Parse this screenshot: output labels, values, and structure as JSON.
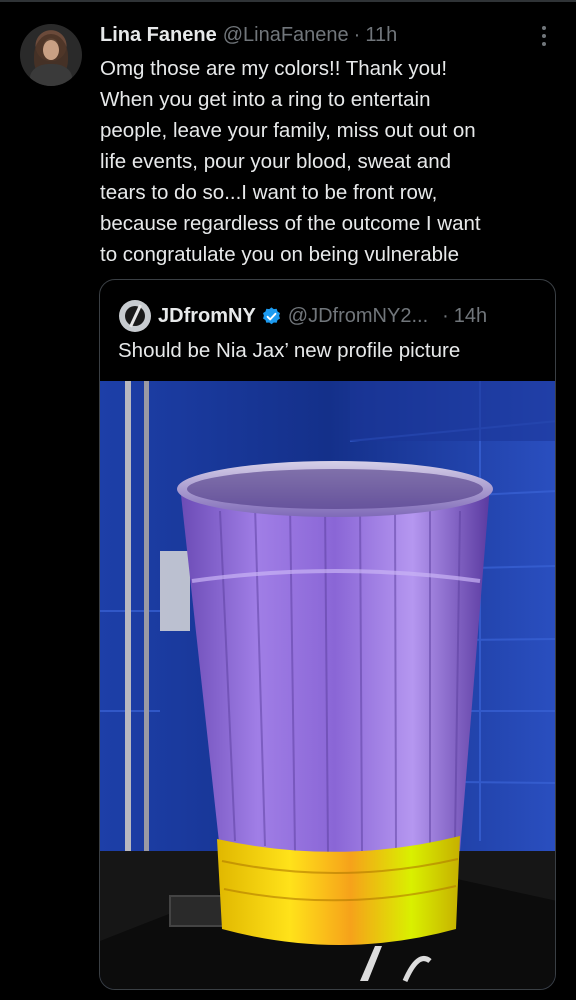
{
  "tweet": {
    "author_name": "Lina Fanene",
    "author_handle": "@LinaFanene",
    "separator": "·",
    "time": "11h",
    "text": "Omg those are my colors!! Thank you!\nWhen you get into a ring to entertain\npeople, leave your family, miss out out on\nlife events, pour your blood, sweat and\ntears to do so...I  want to be front row,\nbecause regardless of the outcome I want\nto congratulate you on being vulnerable"
  },
  "quoted_tweet": {
    "author_name": "JDfromNY",
    "author_handle": "@JDfromNY2...",
    "separator": "·",
    "time": "14h",
    "text": "Should be Nia Jax’ new profile picture"
  },
  "colors": {
    "background": "#000000",
    "text_primary": "#e7e9ea",
    "text_secondary": "#71767b",
    "verified": "#1d9bf0",
    "border": "#3a3f44"
  },
  "icons": {
    "more": "more-vertical-icon",
    "verified": "verified-badge-icon"
  }
}
